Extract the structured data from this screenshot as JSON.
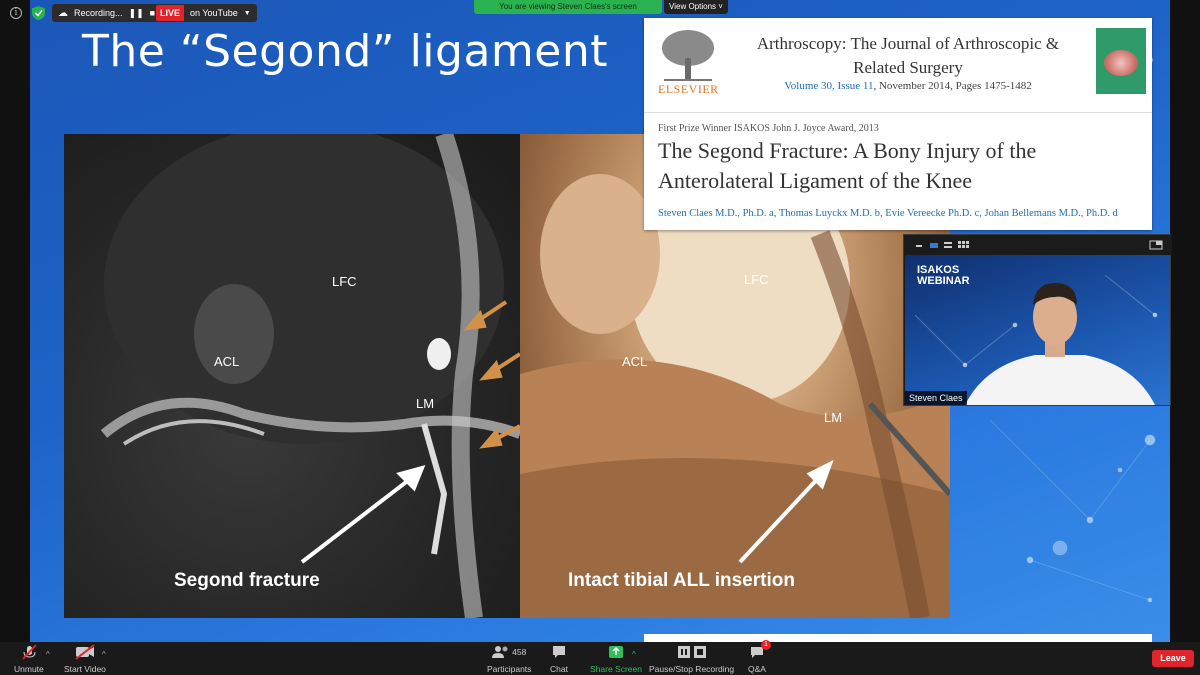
{
  "topbar": {
    "recording_label": "Recording...",
    "live_badge": "LIVE",
    "live_label": "on YouTube",
    "viewing_banner": "You are viewing Steven Claes's screen",
    "view_options": "View Options"
  },
  "slide": {
    "title": "The “Segond” ligament",
    "mri_labels": {
      "lfc": "LFC",
      "acl": "ACL",
      "lm": "LM"
    },
    "anat_labels": {
      "lfc": "LFC",
      "acl": "ACL",
      "lm": "LM"
    },
    "caption_left": "Segond fracture",
    "caption_right": "Intact tibial ALL insertion"
  },
  "journal": {
    "publisher": "ELSEVIER",
    "name_line1": "Arthroscopy: The Journal of Arthroscopic &",
    "name_line2": "Related Surgery",
    "issue_link": "Volume 30, Issue 11",
    "issue_rest": ", November 2014, Pages 1475-1482",
    "award": "First Prize Winner ISAKOS John J. Joyce Award, 2013",
    "article_title": "The Segond Fracture: A Bony Injury of the Anterolateral Ligament of the Knee",
    "authors": "Steven Claes M.D., Ph.D. a, Thomas Luyckx M.D. b, Evie Vereecke Ph.D. c, Johan Bellemans M.D., Ph.D. d"
  },
  "speaker": {
    "logo_line1": "ISAKOS",
    "logo_line2": "WEBINAR",
    "name": "Steven Claes"
  },
  "toolbar": {
    "unmute": "Unmute",
    "start_video": "Start Video",
    "participants_count": "458",
    "participants": "Participants",
    "chat": "Chat",
    "share_screen": "Share Screen",
    "pause_recording": "Pause/Stop Recording",
    "qa": "Q&A",
    "qa_badge": "1",
    "leave": "Leave"
  },
  "colors": {
    "live_red": "#e0242b",
    "share_green": "#2ec05a",
    "slide_blue": "#1e63c8",
    "elsevier_orange": "#e9711c",
    "link_blue": "#1f6fb2"
  }
}
